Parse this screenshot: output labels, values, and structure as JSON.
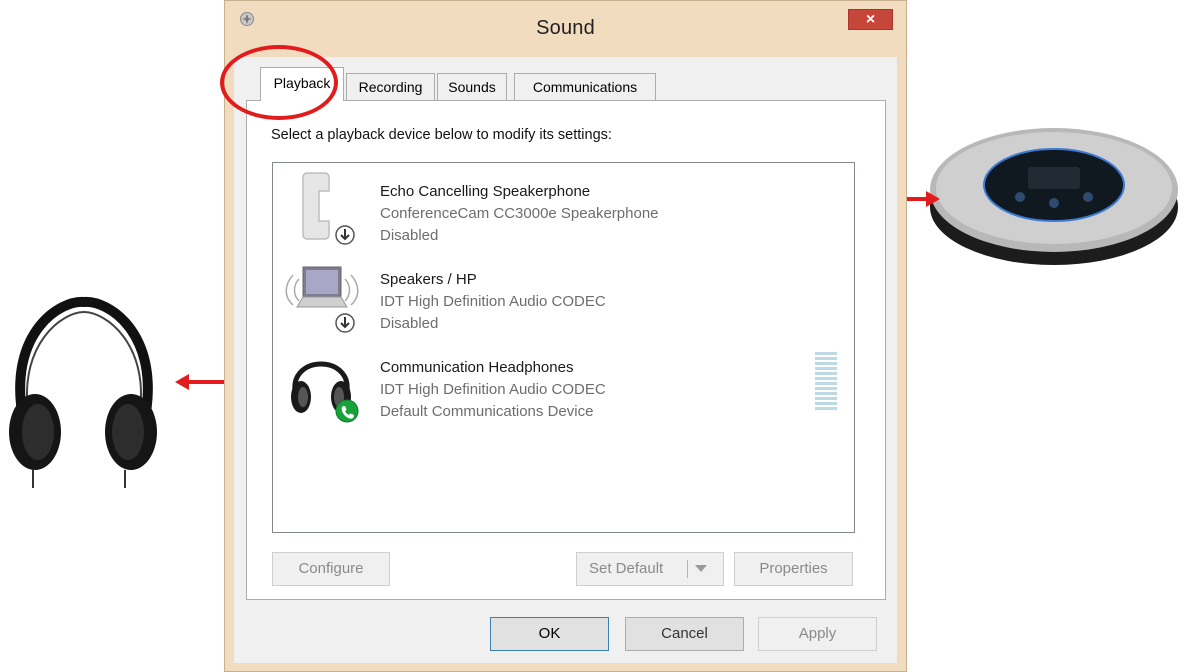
{
  "window": {
    "title": "Sound",
    "close_glyph": "×"
  },
  "tabs": [
    {
      "label": "Playback",
      "active": true
    },
    {
      "label": "Recording",
      "active": false
    },
    {
      "label": "Sounds",
      "active": false
    },
    {
      "label": "Communications",
      "active": false
    }
  ],
  "panel": {
    "instruction": "Select a playback device below to modify its settings:"
  },
  "devices": [
    {
      "name": "Echo Cancelling Speakerphone",
      "description": "ConferenceCam CC3000e Speakerphone",
      "status": "Disabled",
      "icon": "phone-handset-icon"
    },
    {
      "name": "Speakers / HP",
      "description": "IDT High Definition Audio CODEC",
      "status": "Disabled",
      "icon": "laptop-speakers-icon"
    },
    {
      "name": "Communication Headphones",
      "description": "IDT High Definition Audio CODEC",
      "status": "Default Communications Device",
      "icon": "headphones-icon"
    }
  ],
  "buttons": {
    "configure": "Configure",
    "set_default": "Set Default",
    "properties": "Properties",
    "ok": "OK",
    "cancel": "Cancel",
    "apply": "Apply"
  },
  "colors": {
    "annotation_red": "#e21c1c",
    "close_button": "#c7463a",
    "window_frame": "#f1dcbf"
  }
}
